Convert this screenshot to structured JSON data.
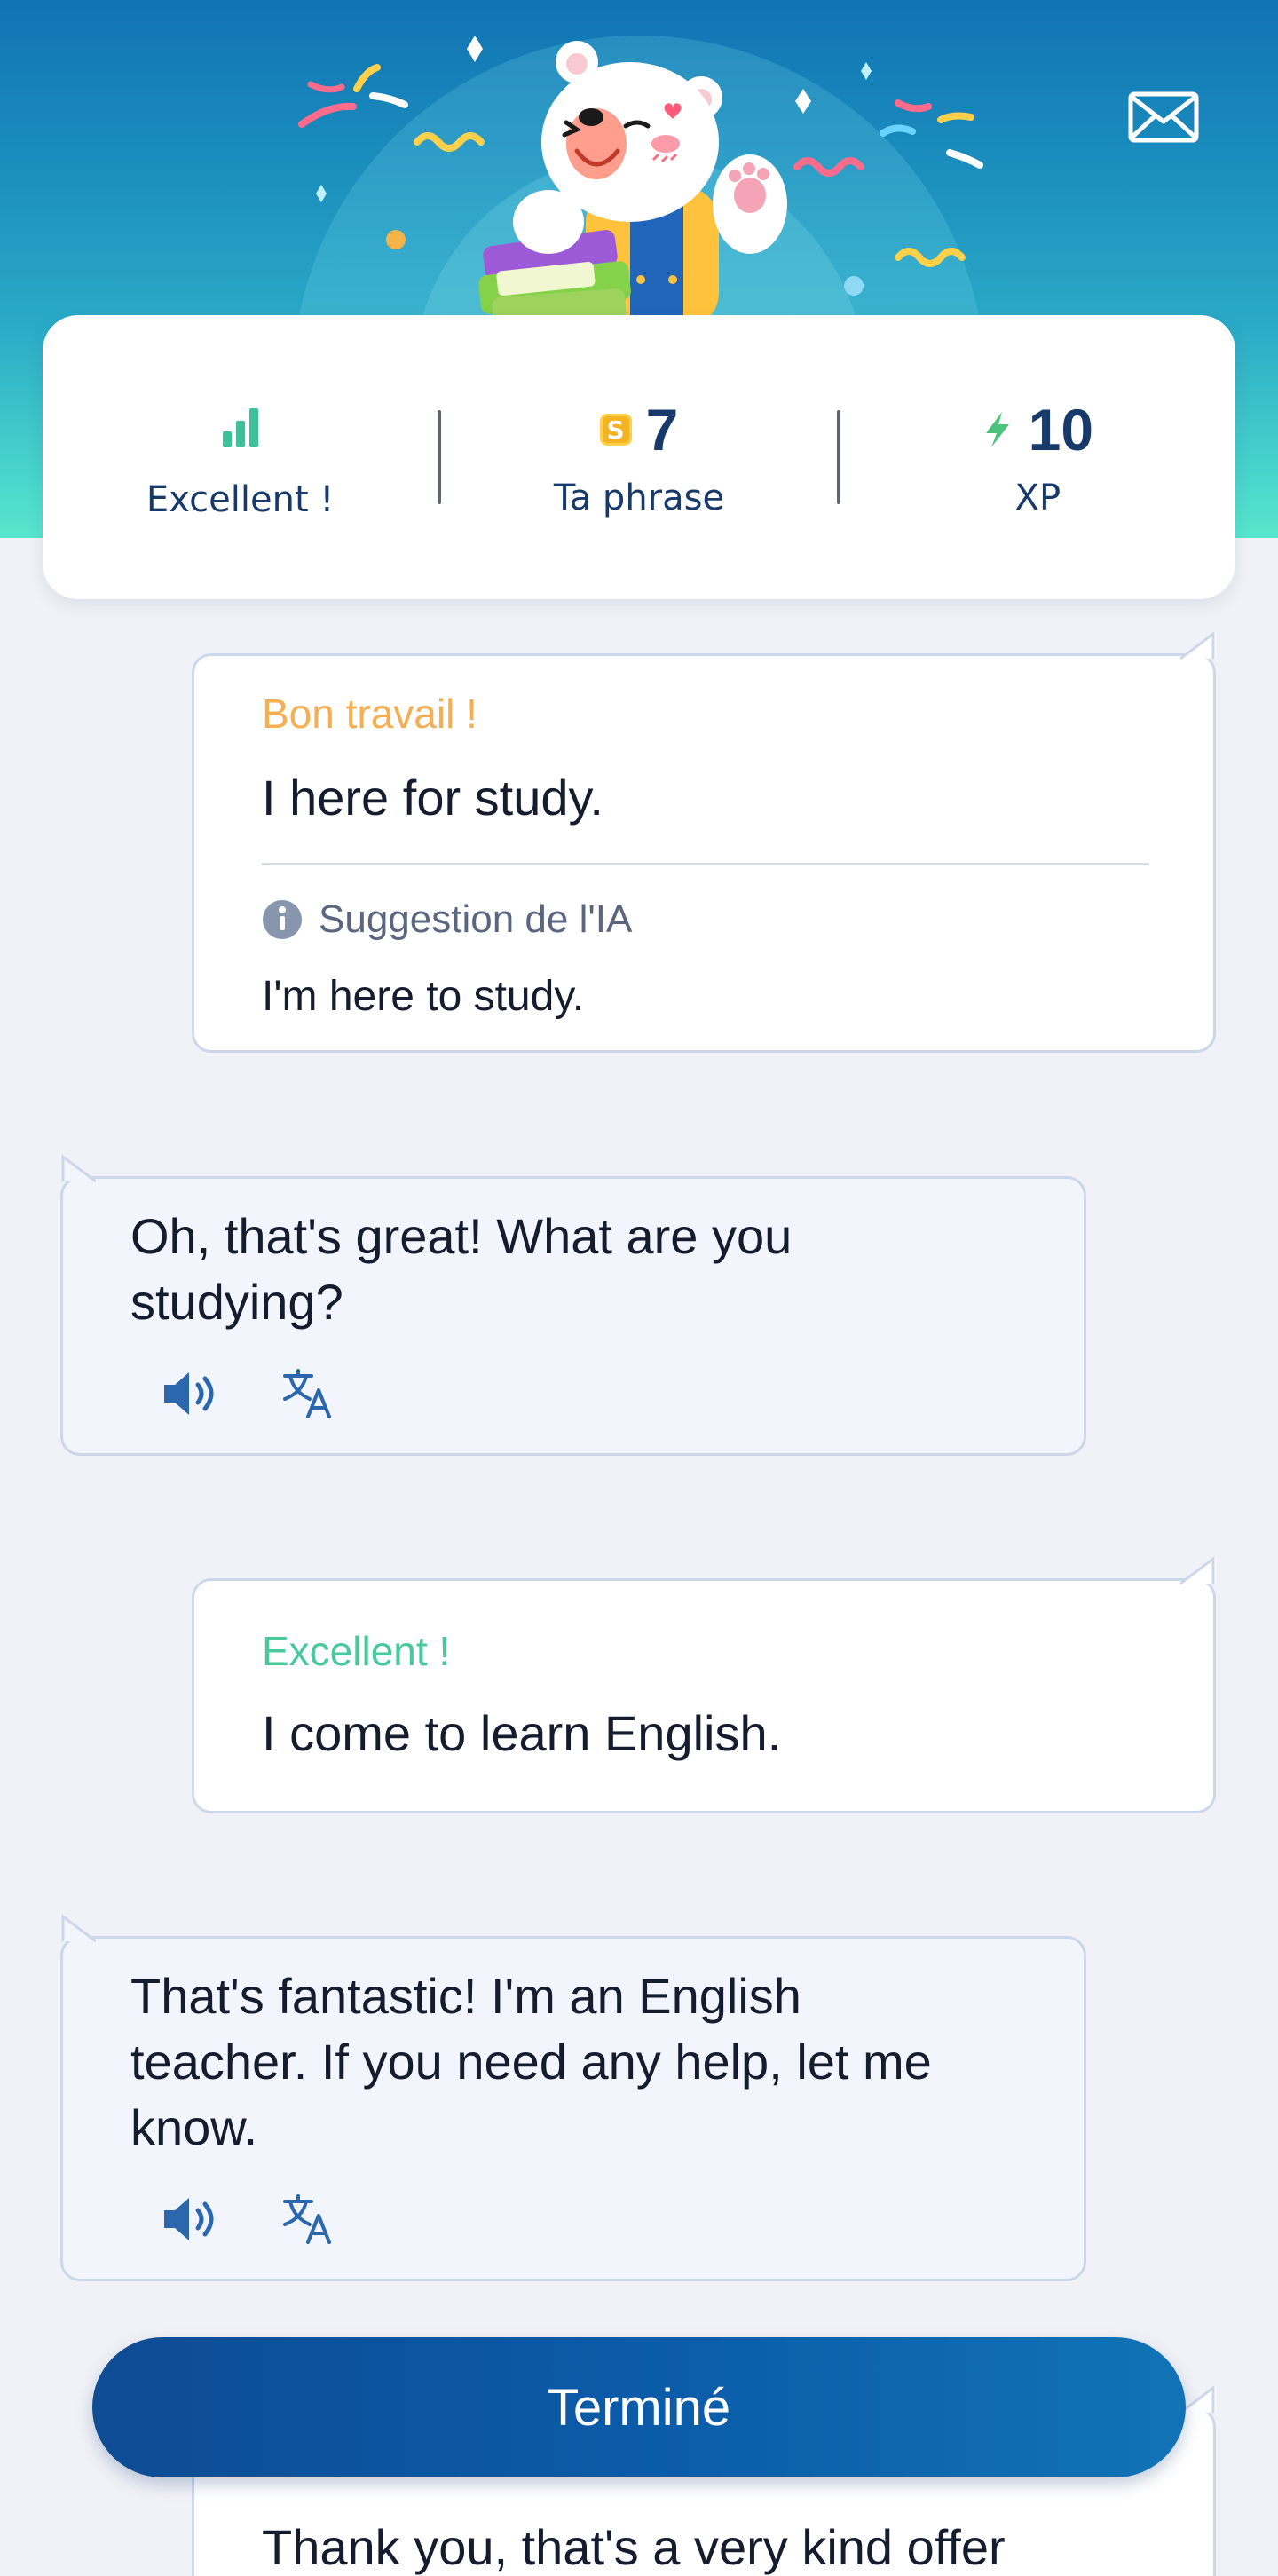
{
  "header": {
    "mail_icon": "envelope-icon",
    "mascot": "polar-bear-with-books-mascot"
  },
  "stats": {
    "rating": {
      "icon": "signal-bars-icon",
      "label": "Excellent !",
      "color": "#3cc29a"
    },
    "sentence": {
      "icon": "coin-s-icon",
      "coin_letter": "S",
      "value": "7",
      "label": "Ta phrase"
    },
    "xp": {
      "icon": "lightning-icon",
      "value": "10",
      "label": "XP"
    }
  },
  "messages": [
    {
      "role": "user",
      "label": "Bon travail !",
      "label_color": "#f5ae52",
      "text": "I here for study.",
      "suggestion_label": "Suggestion de l'IA",
      "suggestion_text": "I'm here to study."
    },
    {
      "role": "bot",
      "lines": [
        "Oh, that's great! What are you",
        "studying?"
      ],
      "actions": [
        "speaker-icon",
        "translate-icon"
      ]
    },
    {
      "role": "user",
      "label": "Excellent !",
      "label_color": "#46c99b",
      "text": "I come to learn English."
    },
    {
      "role": "bot",
      "lines": [
        "That's fantastic! I'm an English",
        "teacher. If you need any help, let me",
        "know."
      ],
      "actions": [
        "speaker-icon",
        "translate-icon"
      ]
    },
    {
      "role": "user",
      "text": "Thank you, that's a very kind offer"
    }
  ],
  "footer": {
    "done_label": "Terminé"
  },
  "colors": {
    "brand_blue": "#0b5ba8",
    "accent_orange": "#f5ae52",
    "accent_green": "#46c99b",
    "navy_text": "#173a6b"
  }
}
